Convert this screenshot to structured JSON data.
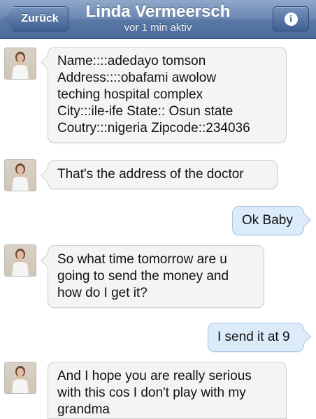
{
  "header": {
    "back_label": "Zurück",
    "contact_name": "Linda Vermeersch",
    "status": "vor 1 min aktiv",
    "info_icon": "info-icon"
  },
  "messages": [
    {
      "direction": "incoming",
      "lines": [
        "Name::::adedayo tomson",
        "Address::::obafami awolow",
        "teching hospital complex",
        "City:::ile-ife State:: Osun state",
        "Coutry:::nigeria Zipcode::234036"
      ]
    },
    {
      "direction": "incoming",
      "lines": [
        "That's the address of the doctor"
      ]
    },
    {
      "direction": "outgoing",
      "lines": [
        "Ok Baby"
      ]
    },
    {
      "direction": "incoming",
      "lines": [
        "So what time tomorrow are u",
        "going to send the money and",
        "how do I get it?"
      ]
    },
    {
      "direction": "outgoing",
      "lines": [
        "I send it at 9"
      ]
    },
    {
      "direction": "incoming",
      "lines": [
        "And I hope you are really serious",
        "with this cos I don't play with my",
        "grandma"
      ]
    }
  ],
  "colors": {
    "navbar": "#5a79a6",
    "incoming_bubble": "#f4f4f4",
    "outgoing_bubble": "#dcebfa"
  }
}
